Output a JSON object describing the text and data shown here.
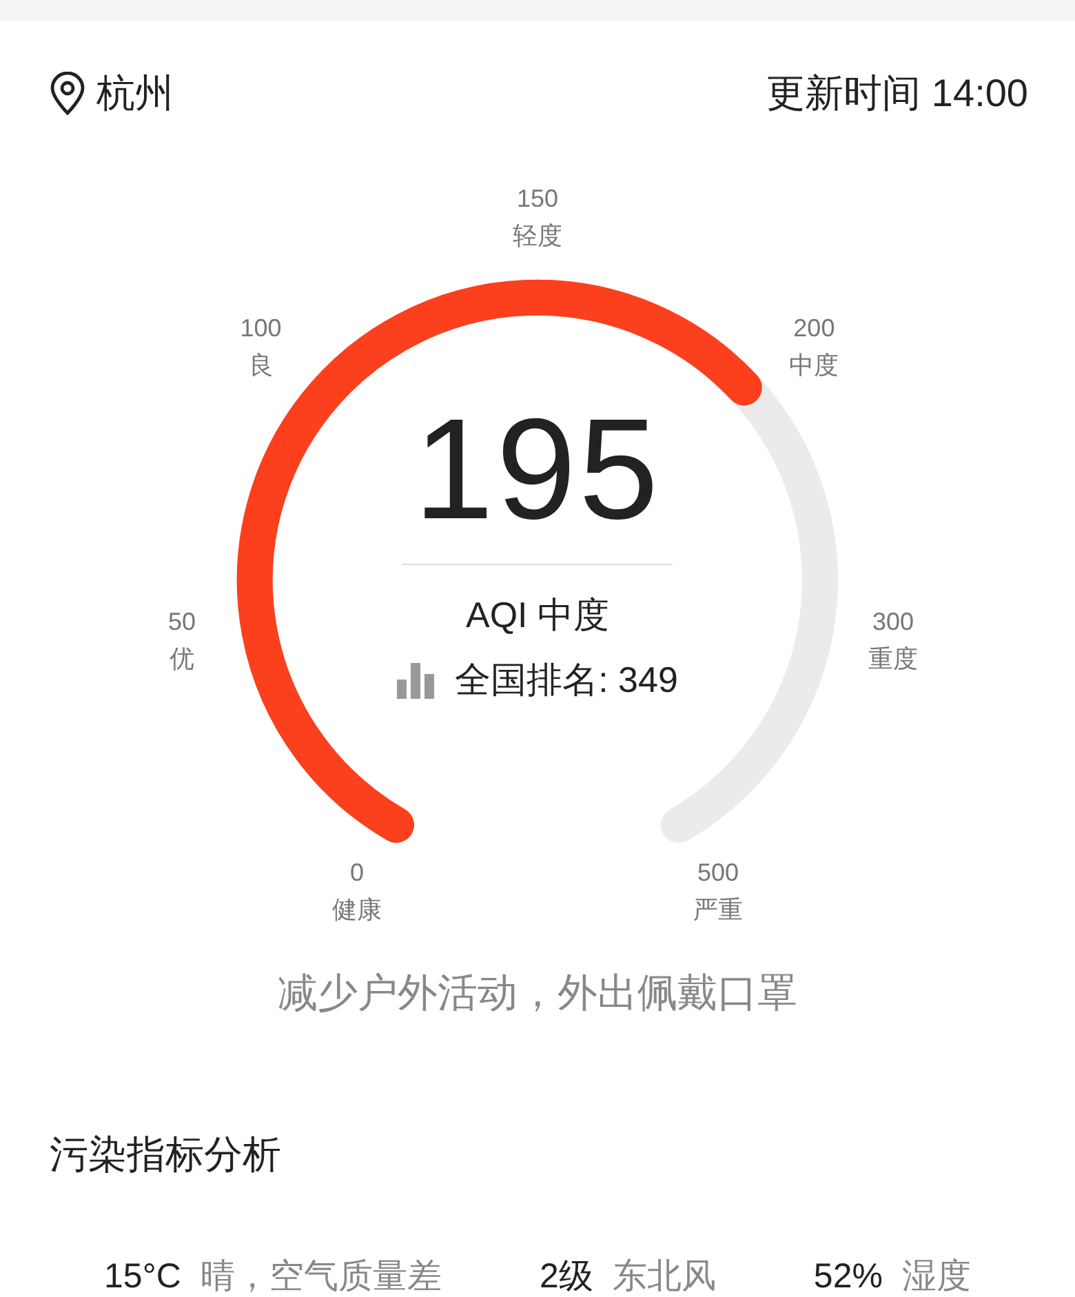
{
  "header": {
    "city": "杭州",
    "update_time": "更新时间 14:00"
  },
  "gauge": {
    "value": "195",
    "category": "AQI 中度",
    "rank": "全国排名: 349",
    "ticks": [
      {
        "value": "0",
        "label": "健康"
      },
      {
        "value": "50",
        "label": "优"
      },
      {
        "value": "100",
        "label": "良"
      },
      {
        "value": "150",
        "label": "轻度"
      },
      {
        "value": "200",
        "label": "中度"
      },
      {
        "value": "300",
        "label": "重度"
      },
      {
        "value": "500",
        "label": "严重"
      }
    ]
  },
  "advice": "减少户外活动，外出佩戴口罩",
  "section_title": "污染指标分析",
  "stats": [
    {
      "value": "15°C",
      "label": "晴，空气质量差"
    },
    {
      "value": "2级",
      "label": "东北风"
    },
    {
      "value": "52%",
      "label": "湿度"
    }
  ]
}
